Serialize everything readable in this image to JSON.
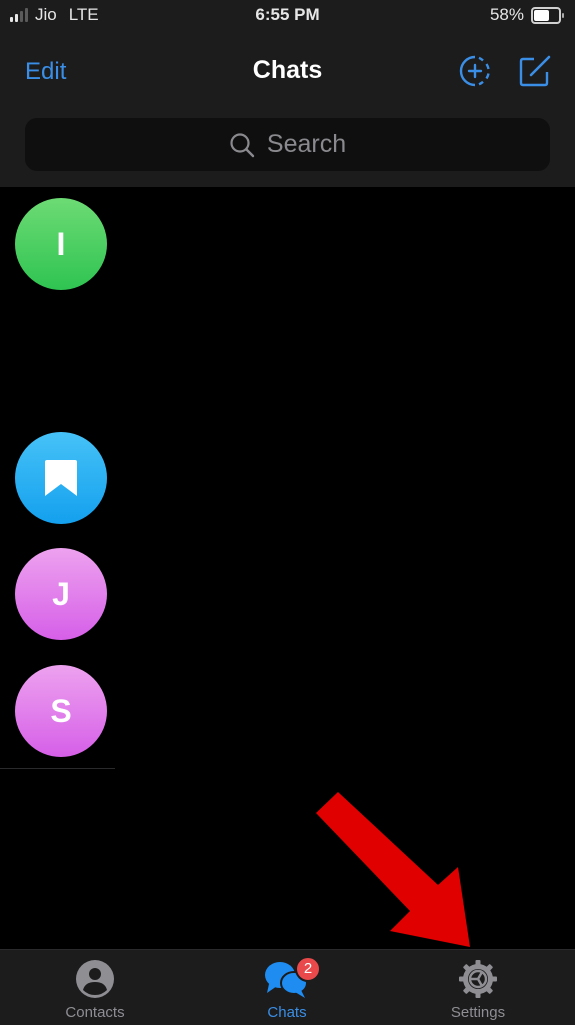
{
  "status_bar": {
    "carrier": "Jio",
    "network": "LTE",
    "time": "6:55 PM",
    "battery_percent_label": "58%",
    "battery_level": 0.58,
    "signal_bars_active": 2,
    "signal_bars_total": 4
  },
  "header": {
    "edit_label": "Edit",
    "title": "Chats",
    "new_story_icon": "add-circle-dashed-icon",
    "compose_icon": "compose-icon"
  },
  "search": {
    "placeholder": "Search"
  },
  "chat_list": [
    {
      "initial": "I",
      "avatar_color": "#3ecf5e"
    },
    {
      "initial": "",
      "avatar_icon": "bookmark-icon",
      "avatar_color": "#22aaf2"
    },
    {
      "initial": "J",
      "avatar_color": "#e17ceb"
    },
    {
      "initial": "S",
      "avatar_color": "#e17ceb"
    }
  ],
  "annotation": {
    "arrow_color": "#e00000",
    "points_to": "Settings"
  },
  "tab_bar": {
    "tabs": [
      {
        "label": "Contacts",
        "icon": "person-circle-icon",
        "active": false
      },
      {
        "label": "Chats",
        "icon": "chat-bubbles-icon",
        "active": true,
        "badge": "2"
      },
      {
        "label": "Settings",
        "icon": "gear-icon",
        "active": false
      }
    ]
  },
  "colors": {
    "accent": "#3a8ee6",
    "badge": "#e9494a",
    "bar_background": "#1c1c1d"
  }
}
